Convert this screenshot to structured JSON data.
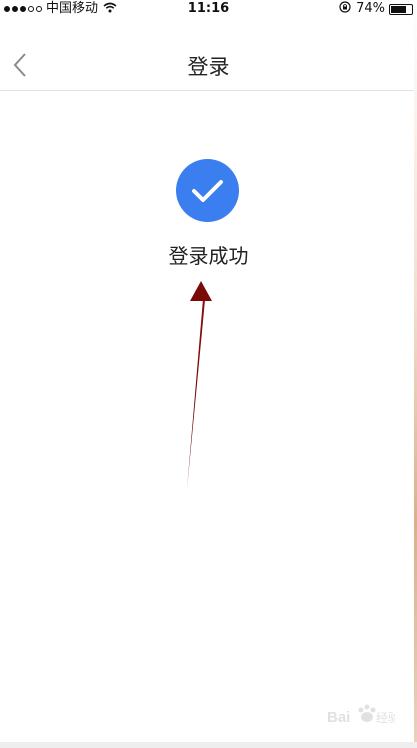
{
  "status_bar": {
    "carrier": "中国移动",
    "time": "11:16",
    "battery": "74%",
    "battery_level": 0.74
  },
  "nav": {
    "title": "登录",
    "back_icon": "chevron-left-icon"
  },
  "content": {
    "success_icon": "checkmark-icon",
    "success_text": "登录成功"
  },
  "colors": {
    "accent": "#3b7ef0",
    "arrow": "#7a0a0a"
  }
}
